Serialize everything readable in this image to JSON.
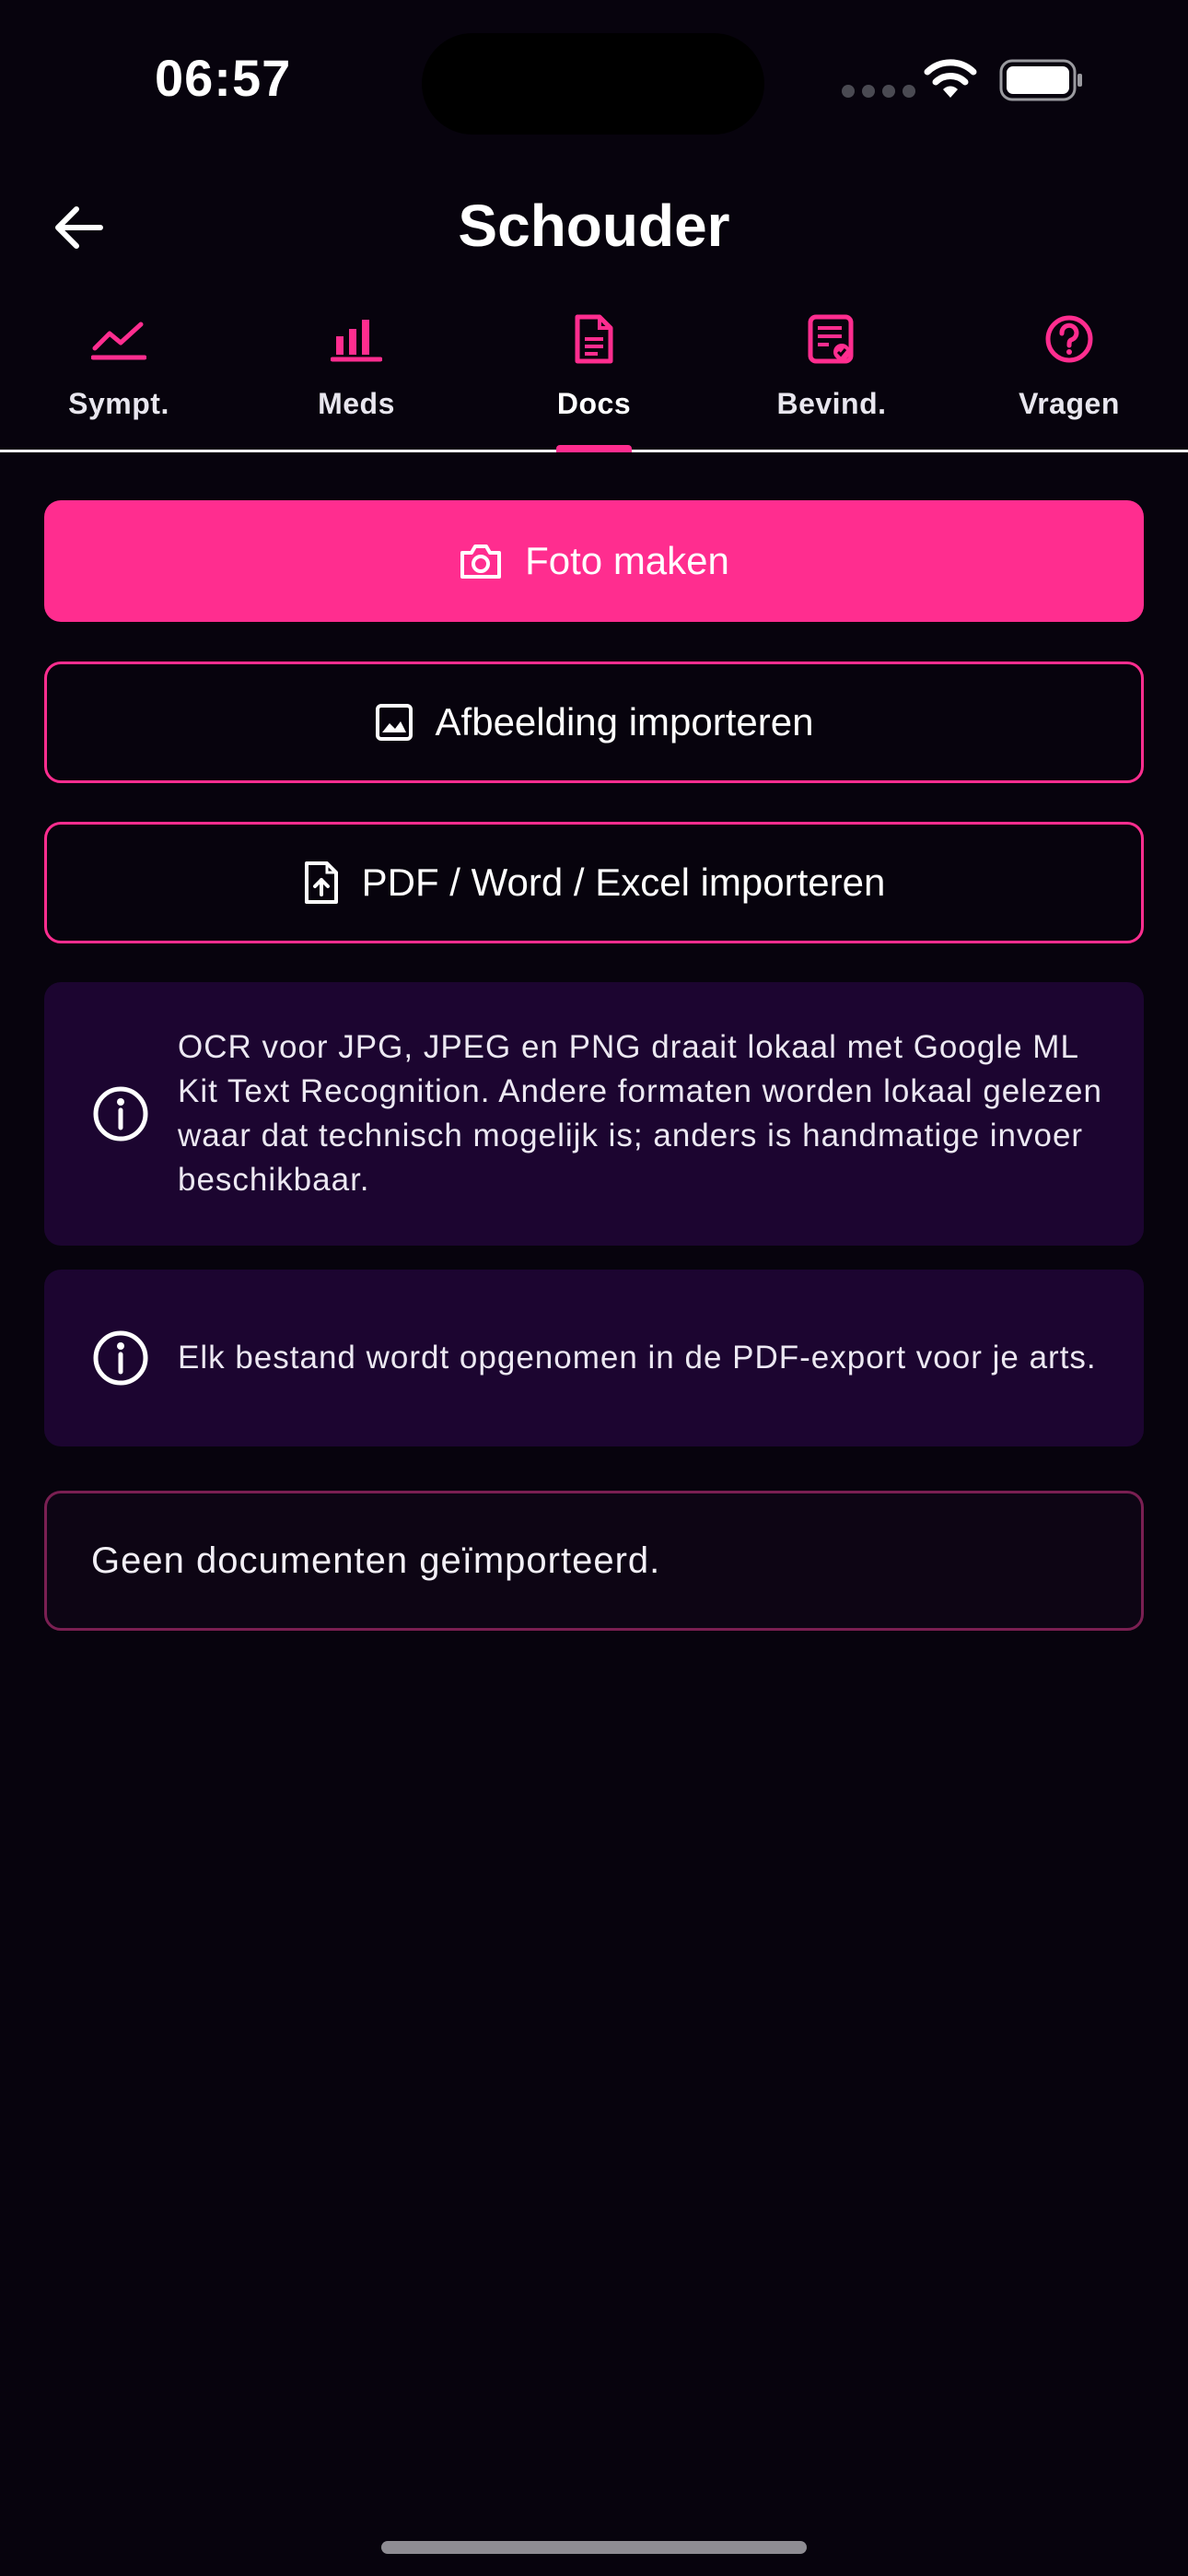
{
  "status_bar": {
    "time": "06:57"
  },
  "header": {
    "title": "Schouder"
  },
  "tabs": [
    {
      "label": "Sympt.",
      "icon": "trend-chart-icon",
      "active": false
    },
    {
      "label": "Meds",
      "icon": "bar-chart-icon",
      "active": false
    },
    {
      "label": "Docs",
      "icon": "document-icon",
      "active": true
    },
    {
      "label": "Bevind.",
      "icon": "report-check-icon",
      "active": false
    },
    {
      "label": "Vragen",
      "icon": "help-circle-icon",
      "active": false
    }
  ],
  "actions": {
    "take_photo": "Foto maken",
    "import_image": "Afbeelding importeren",
    "import_document": "PDF / Word / Excel importeren"
  },
  "info": {
    "ocr": "OCR voor JPG, JPEG en PNG draait lokaal met Google ML Kit Text Recognition. Andere formaten worden lokaal gelezen waar dat technisch mogelijk is; anders is handmatige invoer beschikbaar.",
    "export": "Elk bestand wordt opgenomen in de PDF-export voor je arts."
  },
  "documents": {
    "empty_message": "Geen documenten geïmporteerd."
  },
  "colors": {
    "accent": "#ff2d8f",
    "background": "#07030d",
    "info_card": "#1c0530"
  }
}
